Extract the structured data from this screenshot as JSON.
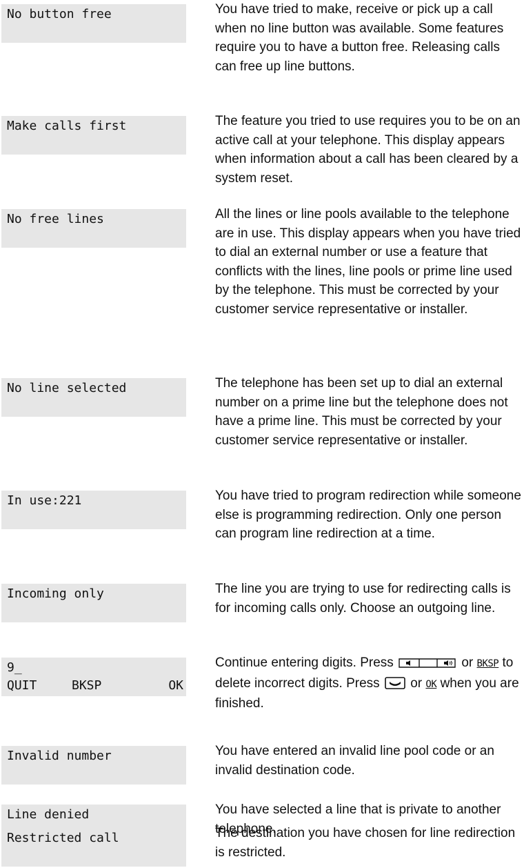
{
  "entries": [
    {
      "display": "No button free",
      "text": "You have tried to make, receive or pick up a call when no line button was available. Some features require you to have a button free. Releasing calls can free up line buttons."
    },
    {
      "display": "Make calls first",
      "text": "The feature you tried to use requires you to be on an active call at your telephone. This display appears when information about a call has been cleared by a system reset."
    },
    {
      "display": "No free lines",
      "text": "All the lines or line pools available to the telephone are in use. This display appears when you have tried to dial an external number or use a feature that conflicts with the lines, line pools or prime line used by the telephone. This must be corrected by your customer service representative or installer."
    },
    {
      "display": "No line selected",
      "text": "The telephone has been set up to dial an external number on a prime line but the telephone does not have a prime line. This must be corrected by your customer service representative or installer."
    },
    {
      "display": "In use:221",
      "text": "You have tried to program redirection while someone else is programming redirection. Only one person can program line redirection at a time."
    },
    {
      "display": "Incoming only",
      "text": "The line you are trying to use for redirecting calls is for incoming calls only. Choose an outgoing line."
    },
    {
      "display": "9_",
      "softkeys": [
        "QUIT",
        "BKSP",
        "OK"
      ],
      "text_parts": {
        "p1": "Continue entering digits. Press",
        "p2": "or",
        "bksp": "BKSP",
        "p3": "to delete incorrect digits. Press",
        "p4": "or",
        "ok": "OK",
        "p5": "when you are finished."
      },
      "icons": [
        "volume-control-bar-icon",
        "handsfree-key-icon"
      ]
    },
    {
      "display": "Invalid number",
      "text": "You have entered an invalid line pool code or an invalid destination code."
    },
    {
      "display": "Line denied",
      "text": "You have selected a line that is private to another telephone."
    },
    {
      "display": "Restricted call",
      "text": "The destination you have chosen for line redirection is restricted."
    }
  ]
}
